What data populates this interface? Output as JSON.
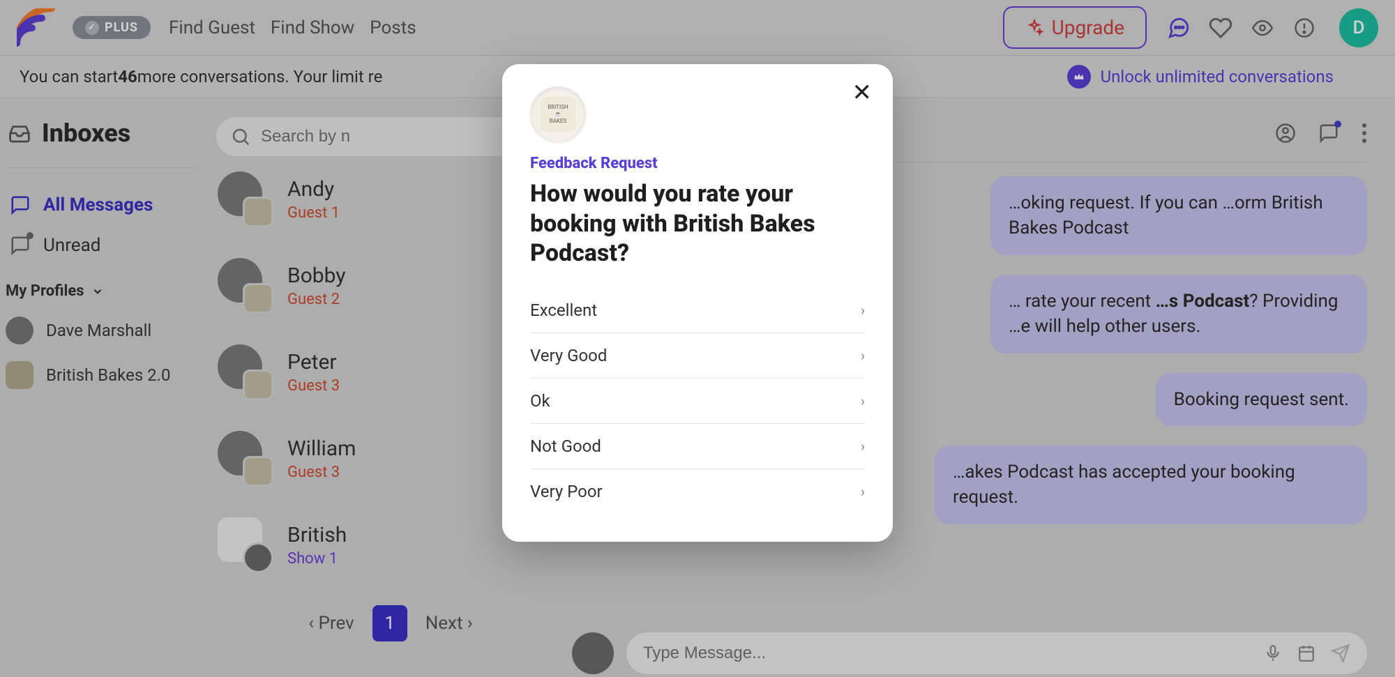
{
  "header": {
    "plus": "PLUS",
    "nav": {
      "find_guest": "Find Guest",
      "find_show": "Find Show",
      "posts": "Posts"
    },
    "upgrade": "Upgrade",
    "avatar_letter": "D"
  },
  "subheader": {
    "prefix": "You can start ",
    "count": "46",
    "suffix": " more conversations. Your limit re",
    "unlock": "Unlock unlimited conversations"
  },
  "sidebar": {
    "title": "Inboxes",
    "all": "All Messages",
    "unread": "Unread",
    "my_profiles": "My Profiles",
    "profiles": [
      {
        "name": "Dave Marshall"
      },
      {
        "name": "British Bakes 2.0"
      }
    ]
  },
  "search": {
    "placeholder": "Search by n"
  },
  "conversations": [
    {
      "name": "Andy",
      "meta": "Guest  1",
      "type": "guest"
    },
    {
      "name": "Bobby",
      "meta": "Guest  2",
      "type": "guest"
    },
    {
      "name": "Peter",
      "meta": "Guest  3",
      "type": "guest"
    },
    {
      "name": "William",
      "meta": "Guest  3",
      "type": "guest"
    },
    {
      "name": "British",
      "meta": "Show  1",
      "type": "show"
    }
  ],
  "pager": {
    "prev": "‹ Prev",
    "page1": "1",
    "next": "Next ›"
  },
  "chat": {
    "b1": "…oking request. If you can …orm British Bakes Podcast",
    "b2_pre": "… rate your recent ",
    "b2_bold": "…s Podcast",
    "b2_post": "? Providing …e will help other users.",
    "b3": "Booking request sent.",
    "b4": "…akes Podcast has accepted your booking request.",
    "placeholder": "Type Message..."
  },
  "modal": {
    "badge_top": "BRITISH",
    "badge_bottom": "BAKES",
    "eyebrow": "Feedback Request",
    "title": "How would you rate your booking with British Bakes Podcast?",
    "options": [
      "Excellent",
      "Very Good",
      "Ok",
      "Not Good",
      "Very Poor"
    ]
  }
}
